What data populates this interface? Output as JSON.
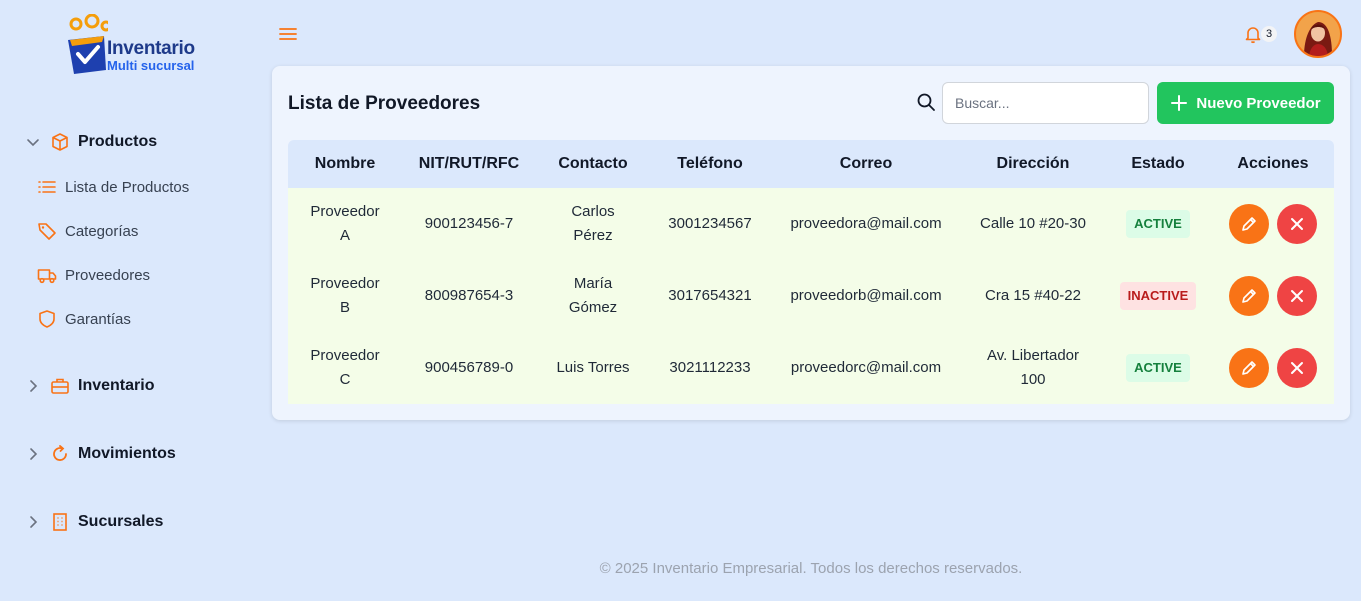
{
  "brand": {
    "title": "Inventario",
    "subtitle": "Multi sucursal"
  },
  "sidebar": {
    "groups": [
      {
        "label": "Productos",
        "expanded": true,
        "icon": "box-icon",
        "items": [
          {
            "label": "Lista de Productos",
            "icon": "list-icon"
          },
          {
            "label": "Categorías",
            "icon": "tag-icon"
          },
          {
            "label": "Proveedores",
            "icon": "truck-icon"
          },
          {
            "label": "Garantías",
            "icon": "shield-icon"
          }
        ]
      },
      {
        "label": "Inventario",
        "expanded": false,
        "icon": "briefcase-icon"
      },
      {
        "label": "Movimientos",
        "expanded": false,
        "icon": "refresh-icon"
      },
      {
        "label": "Sucursales",
        "expanded": false,
        "icon": "building-icon"
      }
    ]
  },
  "topbar": {
    "notifications_count": "3"
  },
  "main": {
    "title": "Lista de Proveedores",
    "search_placeholder": "Buscar...",
    "new_button": "Nuevo Proveedor",
    "columns": [
      "Nombre",
      "NIT/RUT/RFC",
      "Contacto",
      "Teléfono",
      "Correo",
      "Dirección",
      "Estado",
      "Acciones"
    ],
    "rows": [
      {
        "nombre": "Proveedor A",
        "nit": "900123456-7",
        "contacto": "Carlos Pérez",
        "telefono": "3001234567",
        "correo": "proveedora@mail.com",
        "direccion": "Calle 10 #20-30",
        "estado": "ACTIVE"
      },
      {
        "nombre": "Proveedor B",
        "nit": "800987654-3",
        "contacto": "María Gómez",
        "telefono": "3017654321",
        "correo": "proveedorb@mail.com",
        "direccion": "Cra 15 #40-22",
        "estado": "INACTIVE"
      },
      {
        "nombre": "Proveedor C",
        "nit": "900456789-0",
        "contacto": "Luis Torres",
        "telefono": "3021112233",
        "correo": "proveedorc@mail.com",
        "direccion": "Av. Libertador 100",
        "estado": "ACTIVE"
      }
    ]
  },
  "footer": "© 2025 Inventario Empresarial. Todos los derechos reservados.",
  "colors": {
    "accent": "#f97316",
    "success": "#22c55e",
    "danger": "#ef4444",
    "background": "#dbe8fc"
  }
}
